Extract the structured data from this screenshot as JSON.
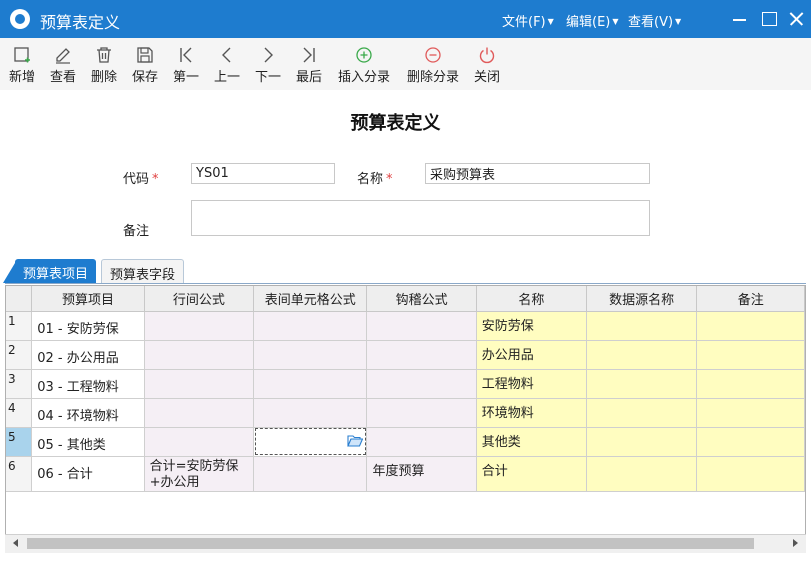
{
  "window": {
    "title": "预算表定义",
    "menus": [
      {
        "label": "文件(F)"
      },
      {
        "label": "编辑(E)"
      },
      {
        "label": "查看(V)"
      }
    ]
  },
  "toolbar": {
    "buttons": [
      {
        "label": "新增",
        "icon": "add-icon"
      },
      {
        "label": "查看",
        "icon": "edit-icon"
      },
      {
        "label": "删除",
        "icon": "trash-icon"
      },
      {
        "label": "保存",
        "icon": "save-icon"
      },
      {
        "label": "第一",
        "icon": "first-icon"
      },
      {
        "label": "上一",
        "icon": "prev-icon"
      },
      {
        "label": "下一",
        "icon": "next-icon"
      },
      {
        "label": "最后",
        "icon": "last-icon"
      },
      {
        "label": "插入分录",
        "icon": "plus-circle-icon",
        "color": "#3aa94a"
      },
      {
        "label": "删除分录",
        "icon": "minus-circle-icon",
        "color": "#e05a5a"
      },
      {
        "label": "关闭",
        "icon": "power-icon",
        "color": "#e05a5a"
      }
    ]
  },
  "form": {
    "title": "预算表定义",
    "code_label": "代码",
    "code_value": "YS01",
    "name_label": "名称",
    "name_value": "采购预算表",
    "note_label": "备注",
    "note_value": "",
    "required_mark": "*"
  },
  "tabs": [
    {
      "label": "预算表项目",
      "active": true
    },
    {
      "label": "预算表字段",
      "active": false
    }
  ],
  "grid": {
    "columns": [
      "预算项目",
      "行间公式",
      "表间单元格公式",
      "钩稽公式",
      "名称",
      "数据源名称",
      "备注"
    ],
    "rows": [
      {
        "num": "1",
        "item": "01 - 安防劳保",
        "row_formula": "",
        "cell_formula": "",
        "check_formula": "",
        "name": "安防劳保",
        "source": "",
        "note": ""
      },
      {
        "num": "2",
        "item": "02 - 办公用品",
        "row_formula": "",
        "cell_formula": "",
        "check_formula": "",
        "name": "办公用品",
        "source": "",
        "note": ""
      },
      {
        "num": "3",
        "item": "03 - 工程物料",
        "row_formula": "",
        "cell_formula": "",
        "check_formula": "",
        "name": "工程物料",
        "source": "",
        "note": ""
      },
      {
        "num": "4",
        "item": "04 - 环境物料",
        "row_formula": "",
        "cell_formula": "",
        "check_formula": "",
        "name": "环境物料",
        "source": "",
        "note": ""
      },
      {
        "num": "5",
        "item": "05 - 其他类",
        "row_formula": "",
        "cell_formula": "",
        "check_formula": "",
        "name": "其他类",
        "source": "",
        "note": ""
      },
      {
        "num": "6",
        "item": "06 - 合计",
        "row_formula": "合计=安防劳保+办公用",
        "cell_formula": "",
        "check_formula": "年度预算",
        "name": "合计",
        "source": "",
        "note": ""
      }
    ],
    "selected_row": 5,
    "focused_cell_icon": "folder-open-icon"
  },
  "colors": {
    "accent": "#1e7ccf",
    "name_cell_bg": "#fffdc0",
    "formula_cell_bg": "#f5eff5",
    "selected_row_bg": "#a9d3ec"
  }
}
